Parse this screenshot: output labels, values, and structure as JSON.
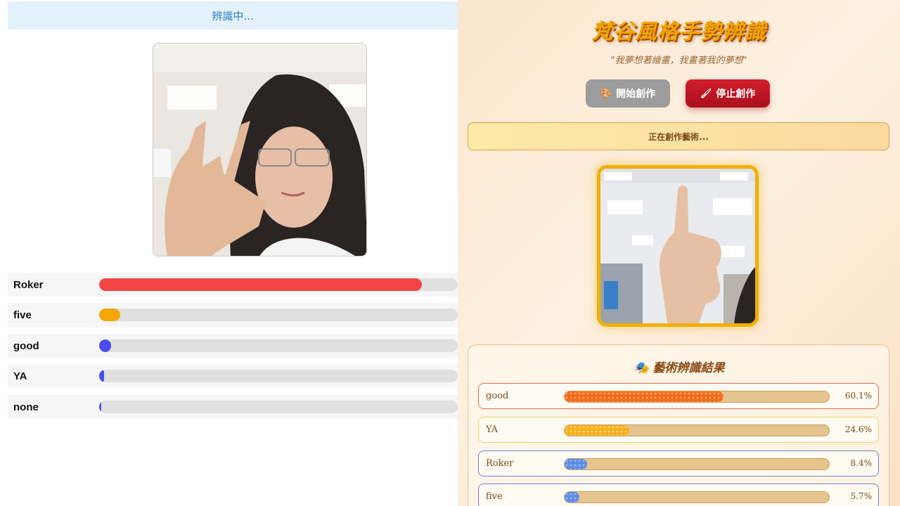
{
  "left": {
    "status": "辨識中...",
    "gestures": [
      {
        "label": "Roker",
        "value": 0.9,
        "color": "#f44545"
      },
      {
        "label": "five",
        "value": 0.058,
        "color": "#f5a40a"
      },
      {
        "label": "good",
        "value": 0.033,
        "color": "#4b4cf0"
      },
      {
        "label": "YA",
        "value": 0.014,
        "color": "#4b4cf0"
      },
      {
        "label": "none",
        "value": 0.004,
        "color": "#4b4cf0"
      }
    ]
  },
  "right": {
    "title": "梵谷風格手勢辨識",
    "quote": "\"我夢想著繪畫，我畫著我的夢想\"",
    "start_button": "開始創作",
    "start_icon": "🎨",
    "stop_button": "停止創作",
    "stop_icon": "🖌",
    "creating_status": "正在創作藝術...",
    "results_title": "藝術辨識結果",
    "results_icon": "🎭",
    "results": [
      {
        "label": "good",
        "value": 0.601,
        "pct": "60.1%",
        "fill": "#f56a16",
        "border": "#e86a5a"
      },
      {
        "label": "YA",
        "value": 0.246,
        "pct": "24.6%",
        "fill": "#f7b01c",
        "border": "#f0d060"
      },
      {
        "label": "Roker",
        "value": 0.084,
        "pct": "8.4%",
        "fill": "#5b8ce8",
        "border": "#6e86c8"
      },
      {
        "label": "five",
        "value": 0.057,
        "pct": "5.7%",
        "fill": "#5b8ce8",
        "border": "#6e86c8"
      }
    ]
  }
}
